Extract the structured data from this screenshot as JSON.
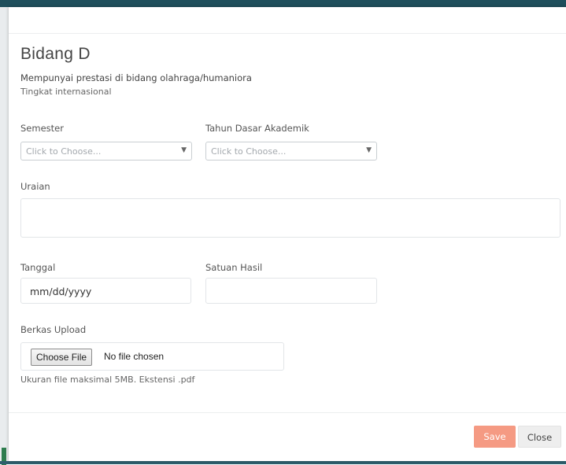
{
  "modal": {
    "title": "Bidang D",
    "subtitle": "Mempunyai prestasi di bidang olahraga/humaniora",
    "level": "Tingkat internasional"
  },
  "form": {
    "semester": {
      "label": "Semester",
      "placeholder": "Click to Choose..."
    },
    "tahun_dasar": {
      "label": "Tahun Dasar Akademik",
      "placeholder": "Click to Choose..."
    },
    "uraian": {
      "label": "Uraian",
      "value": ""
    },
    "tanggal": {
      "label": "Tanggal",
      "value": "mm/dd/yyyy"
    },
    "satuan_hasil": {
      "label": "Satuan Hasil",
      "value": ""
    },
    "berkas_upload": {
      "label": "Berkas Upload",
      "button_label": "Choose File",
      "status": "No file chosen",
      "hint": "Ukuran file maksimal 5MB. Ekstensi .pdf"
    }
  },
  "footer": {
    "save_label": "Save",
    "close_label": "Close"
  },
  "colors": {
    "save_button": "#f59a83",
    "top_bar": "#1f4f5c"
  }
}
